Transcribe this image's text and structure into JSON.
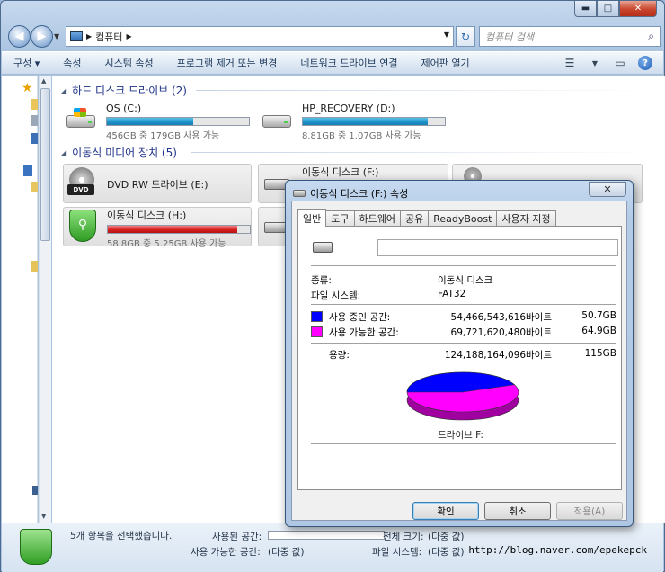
{
  "window": {
    "breadcrumb": "컴퓨터",
    "search_placeholder": "컴퓨터 검색",
    "colors": {
      "accent": "#1e3287",
      "bar_blue": "#1d93c8",
      "bar_red": "#d72020"
    }
  },
  "toolbar": {
    "items": [
      "구성 ▾",
      "속성",
      "시스템 속성",
      "프로그램 제거 또는 변경",
      "네트워크 드라이브 연결",
      "제어판 열기"
    ]
  },
  "groups": {
    "hdd_title": "하드 디스크 드라이브 (2)",
    "removable_title": "이동식 미디어 장치 (5)"
  },
  "drives": {
    "c": {
      "name": "OS (C:)",
      "space": "456GB 중 179GB 사용 가능",
      "used_fraction": 0.61
    },
    "d": {
      "name": "HP_RECOVERY (D:)",
      "space": "8.81GB 중 1.07GB 사용 가능",
      "used_fraction": 0.88
    },
    "e": {
      "name": "DVD RW 드라이브 (E:)"
    },
    "f": {
      "name": "이동식 디스크 (F:)"
    },
    "h": {
      "name": "이동식 디스크 (H:)",
      "space": "58.8GB 중 5.25GB 사용 가능",
      "used_fraction": 0.91
    }
  },
  "status": {
    "selected_text": "5개 항목을 선택했습니다.",
    "used_label": "사용된 공간:",
    "free_label": "사용 가능한 공간:",
    "free_value": "(다중 값)",
    "total_label": "전체 크기:",
    "total_value": "(다중 값)",
    "fs_label": "파일 시스템:",
    "fs_value": "(다중 값)",
    "watermark": "http://blog.naver.com/epekepck"
  },
  "dialog": {
    "title": "이동식 디스크 (F:) 속성",
    "close_glyph": "✕",
    "tabs": [
      "일반",
      "도구",
      "하드웨어",
      "공유",
      "ReadyBoost",
      "사용자 지정"
    ],
    "type_label": "종류:",
    "type_value": "이동식 디스크",
    "fs_label": "파일 시스템:",
    "fs_value": "FAT32",
    "used_label": "사용 중인 공간:",
    "used_bytes": "54,466,543,616바이트",
    "used_size": "50.7GB",
    "free_label": "사용 가능한 공간:",
    "free_bytes": "69,721,620,480바이트",
    "free_size": "64.9GB",
    "capacity_label": "용량:",
    "capacity_bytes": "124,188,164,096바이트",
    "capacity_size": "115GB",
    "drive_label": "드라이브 F:",
    "ok": "확인",
    "cancel": "취소",
    "apply": "적용(A)",
    "used_color": "#0000ff",
    "free_color": "#ff00ff"
  }
}
